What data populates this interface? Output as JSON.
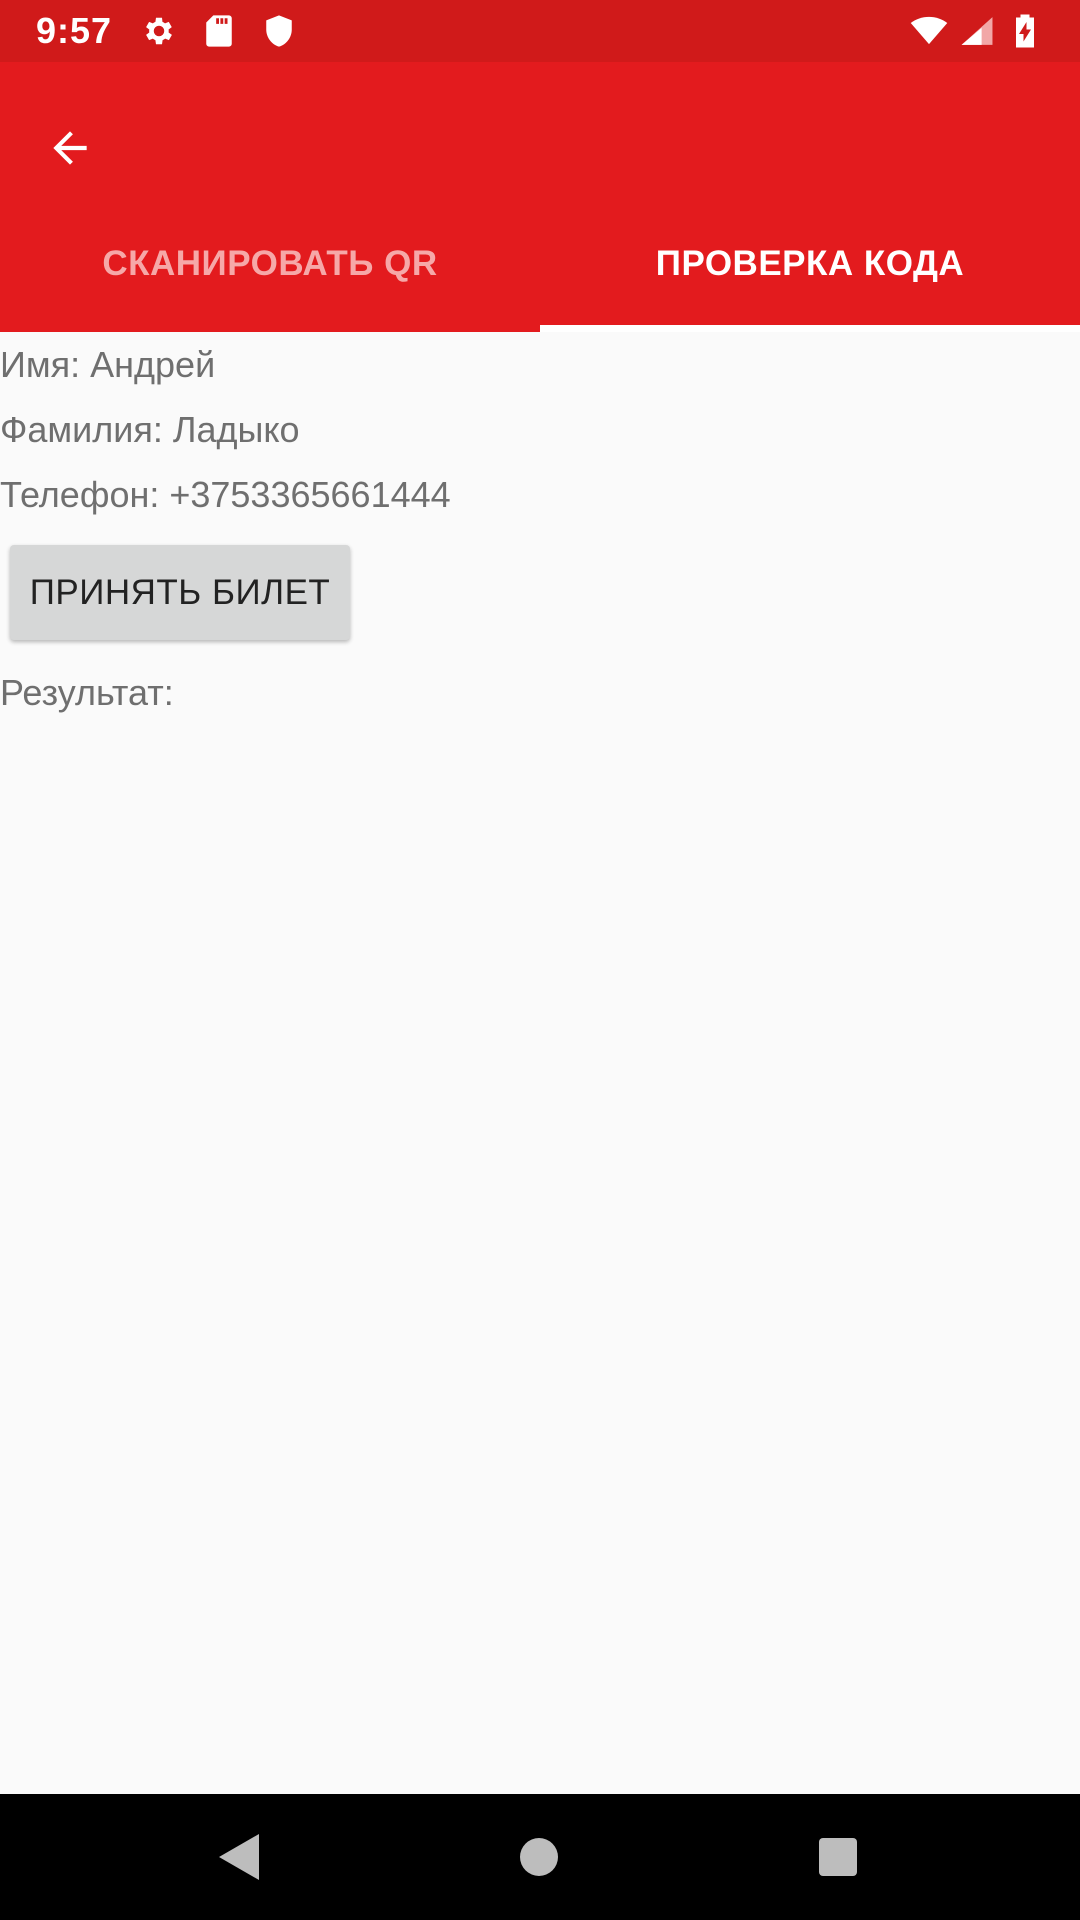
{
  "status_bar": {
    "time": "9:57",
    "left_icons": [
      "gear-icon",
      "sd-card-icon",
      "shield-icon"
    ],
    "right_icons": [
      "wifi-icon",
      "cell-signal-icon",
      "battery-charging-icon"
    ],
    "background": "#d01a1a"
  },
  "app_bar": {
    "background": "#e31b1e",
    "back_icon": "arrow-back-icon",
    "tabs": [
      {
        "label": "СКАНИРОВАТЬ QR",
        "active": false
      },
      {
        "label": "ПРОВЕРКА КОДА",
        "active": true
      }
    ]
  },
  "content": {
    "name_line": "Имя: Андрей",
    "surname_line": "Фамилия: Ладыко",
    "phone_line": "Телефон: +3753365661444",
    "accept_button_label": "ПРИНЯТЬ БИЛЕТ",
    "result_line": "Результат:"
  },
  "nav_bar": {
    "buttons": [
      "nav-back-icon",
      "nav-home-icon",
      "nav-recents-icon"
    ]
  }
}
